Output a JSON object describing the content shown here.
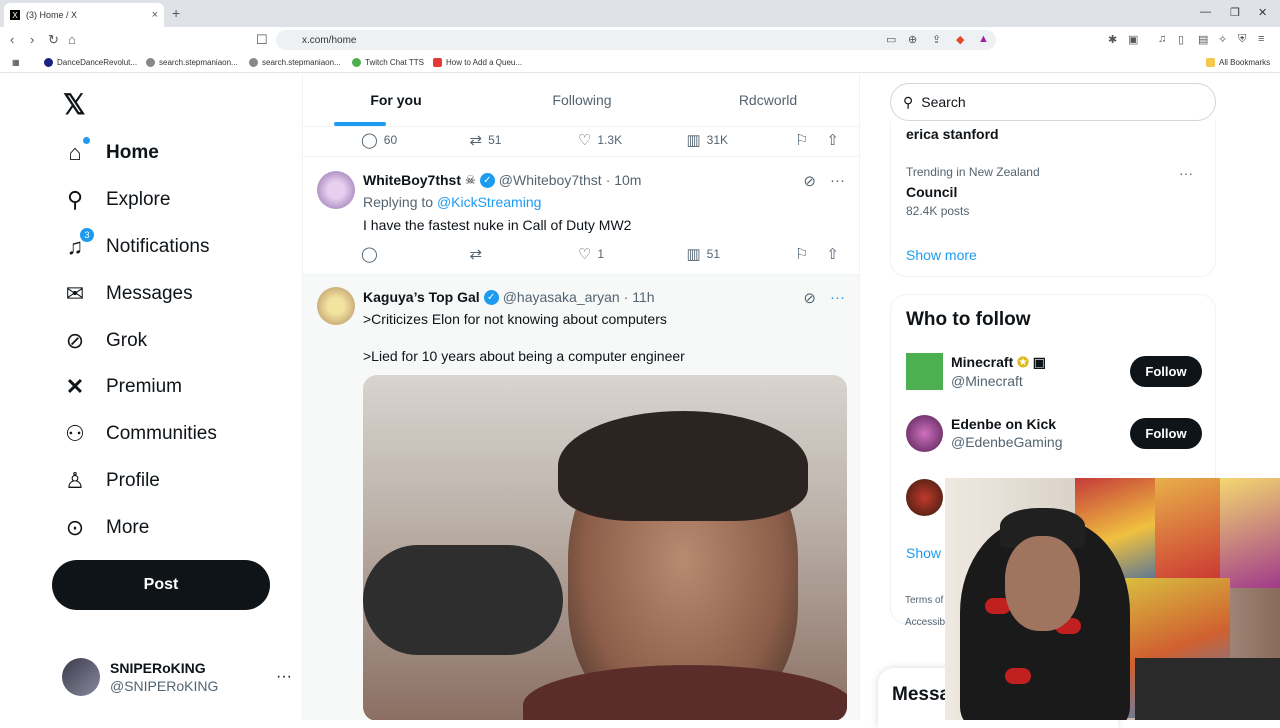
{
  "browser": {
    "tab_title": "(3) Home / X",
    "tab_favicon": "X",
    "tab_close": "×",
    "new_tab": "+",
    "url": "x.com/home",
    "bookmarks": [
      "DanceDanceRevolut...",
      "search.stepmaniaon...",
      "search.stepmaniaon...",
      "Twitch Chat TTS",
      "How to Add a Queu..."
    ],
    "all_bookmarks": "All Bookmarks"
  },
  "sidebar": {
    "logo": "𝕏",
    "items": [
      {
        "label": "Home",
        "icon": "home-icon",
        "glyph": "⌂"
      },
      {
        "label": "Explore",
        "icon": "search-icon",
        "glyph": "⚲"
      },
      {
        "label": "Notifications",
        "icon": "bell-icon",
        "glyph": "🔔",
        "badge": "3"
      },
      {
        "label": "Messages",
        "icon": "mail-icon",
        "glyph": "✉"
      },
      {
        "label": "Grok",
        "icon": "grok-icon",
        "glyph": "⊘"
      },
      {
        "label": "Premium",
        "icon": "x-premium-icon",
        "glyph": "𝕏"
      },
      {
        "label": "Communities",
        "icon": "communities-icon",
        "glyph": "👥"
      },
      {
        "label": "Profile",
        "icon": "profile-icon",
        "glyph": "👤"
      },
      {
        "label": "More",
        "icon": "more-circle-icon",
        "glyph": "⋯"
      }
    ],
    "post_label": "Post",
    "account": {
      "name": "SNIPERoKING",
      "handle": "@SNIPERoKING",
      "more": "···"
    }
  },
  "feed": {
    "tabs": [
      "For you",
      "Following",
      "Rdcworld"
    ],
    "top_actions": {
      "replies": "60",
      "reposts": "51",
      "likes": "1.3K",
      "views": "31K"
    },
    "tweets": [
      {
        "name": "WhiteBoy7thst",
        "name_badge": "🏴‍☠️",
        "handle": "@Whiteboy7thst",
        "time": "· 10m",
        "replying_label": "Replying to",
        "replying_to": "@KickStreaming",
        "text": "I have the fastest nuke in Call of Duty MW2",
        "replies": "",
        "reposts": "",
        "likes": "1",
        "views": "51"
      },
      {
        "name": "Kaguya’s Top Gal",
        "handle": "@hayasaka_aryan",
        "time": "· 11h",
        "line1": ">Criticizes Elon for not knowing about computers",
        "line2": ">Lied for 10 years about being a computer engineer"
      }
    ]
  },
  "right": {
    "search_placeholder": "Search",
    "trends": [
      {
        "title": "erica stanford"
      },
      {
        "meta": "Trending in New Zealand",
        "title": "Council",
        "posts": "82.4K posts"
      }
    ],
    "show_more": "Show more",
    "who_to_follow": "Who to follow",
    "follow_suggestions": [
      {
        "name": "Minecraft",
        "handle": "@Minecraft",
        "button": "Follow"
      },
      {
        "name": "Edenbe on Kick",
        "handle": "@EdenbeGaming",
        "button": "Follow"
      }
    ],
    "show_more_2": "Show",
    "footer_1": "Terms of",
    "footer_2": "Accessibi",
    "messages_dock": "Messa"
  },
  "colors": {
    "accent": "#1d9bf0",
    "text": "#0f1419",
    "muted": "#536471"
  }
}
